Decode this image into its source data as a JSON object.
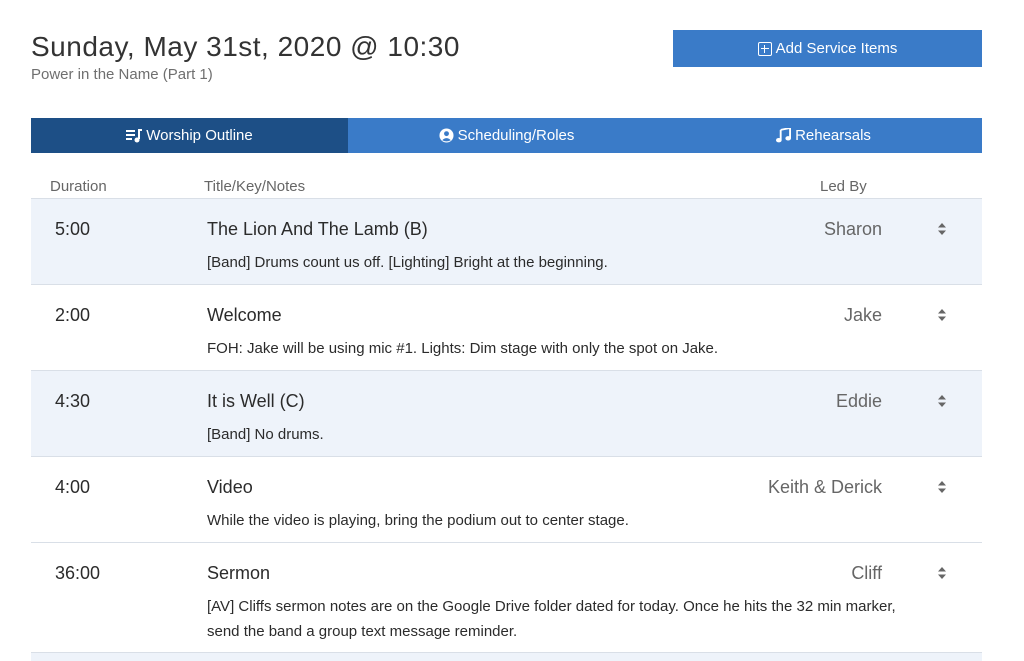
{
  "header": {
    "title": "Sunday, May 31st, 2020 @ 10:30",
    "subtitle": "Power in the Name (Part 1)"
  },
  "actions": {
    "add_service_items": "Add Service Items"
  },
  "tabs": [
    {
      "label": "Worship Outline",
      "icon": "playlist-icon",
      "active": true
    },
    {
      "label": "Scheduling/Roles",
      "icon": "user-circle-icon",
      "active": false
    },
    {
      "label": "Rehearsals",
      "icon": "music-note-icon",
      "active": false
    }
  ],
  "columns": {
    "duration": "Duration",
    "title": "Title/Key/Notes",
    "led_by": "Led By"
  },
  "items": [
    {
      "duration": "5:00",
      "title": "The Lion And The Lamb (B)",
      "notes": "[Band] Drums count us off. [Lighting] Bright at the beginning.",
      "led_by": "Sharon"
    },
    {
      "duration": "2:00",
      "title": "Welcome",
      "notes": "FOH: Jake will be using mic #1. Lights: Dim stage with only the spot on Jake.",
      "led_by": "Jake"
    },
    {
      "duration": "4:30",
      "title": "It is Well (C)",
      "notes": "[Band] No drums.",
      "led_by": "Eddie"
    },
    {
      "duration": "4:00",
      "title": "Video",
      "notes": "While the video is playing, bring the podium out to center stage.",
      "led_by": "Keith & Derick"
    },
    {
      "duration": "36:00",
      "title": "Sermon",
      "notes": "[AV] Cliffs sermon notes are on the Google Drive folder dated for today. Once he hits the 32 min marker, send the band a group text message reminder.",
      "led_by": "Cliff"
    }
  ],
  "colors": {
    "primary": "#3a7bc8",
    "active_tab": "#1d4f86",
    "row_shade": "#eef3fa"
  }
}
